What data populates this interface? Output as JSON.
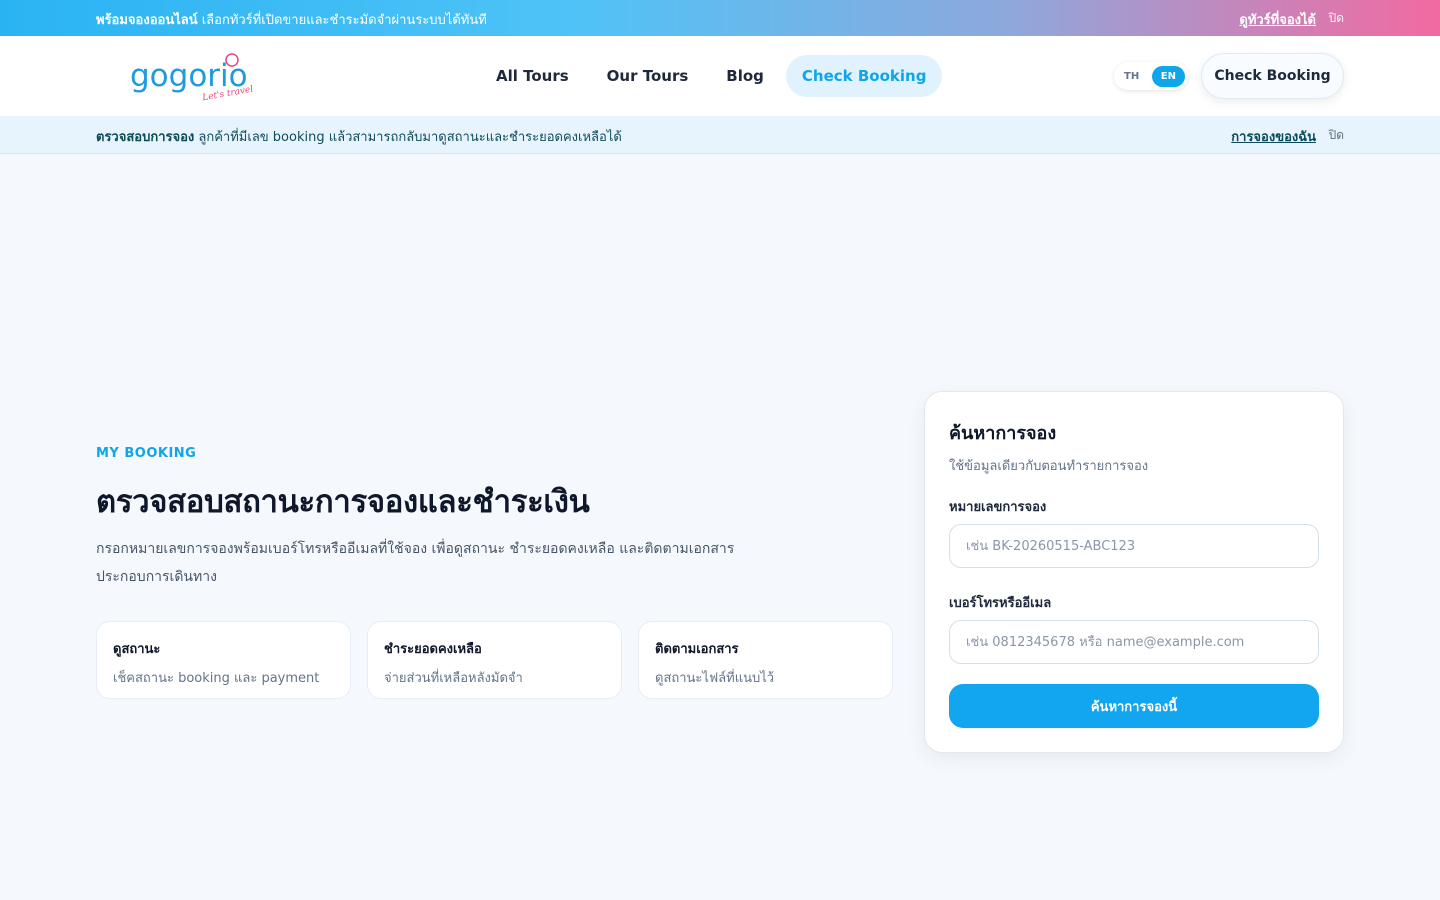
{
  "promo": {
    "bold": "พร้อมจองออนไลน์",
    "text": " เลือกทัวร์ที่เปิดขายและชำระมัดจำผ่านระบบได้ทันที",
    "link": "ดูทัวร์ที่จองได้",
    "close": "ปิด"
  },
  "header": {
    "logo_text": "gogorio",
    "logo_tagline": "Let's travel",
    "nav": [
      "All Tours",
      "Our Tours",
      "Blog",
      "Check Booking"
    ],
    "lang_th": "TH",
    "lang_en": "EN",
    "cta": "Check Booking"
  },
  "notice": {
    "bold": "ตรวจสอบการจอง",
    "text": " ลูกค้าที่มีเลข booking แล้วสามารถกลับมาดูสถานะและชำระยอดคงเหลือได้",
    "link": "การจองของฉัน",
    "close": "ปิด"
  },
  "hero": {
    "eyebrow": "MY BOOKING",
    "title": "ตรวจสอบสถานะการจองและชำระเงิน",
    "description": "กรอกหมายเลขการจองพร้อมเบอร์โทรหรืออีเมลที่ใช้จอง เพื่อดูสถานะ ชำระยอดคงเหลือ และติดตามเอกสารประกอบการเดินทาง"
  },
  "features": [
    {
      "title": "ดูสถานะ",
      "desc": "เช็คสถานะ booking และ payment"
    },
    {
      "title": "ชำระยอดคงเหลือ",
      "desc": "จ่ายส่วนที่เหลือหลังมัดจำ"
    },
    {
      "title": "ติดตามเอกสาร",
      "desc": "ดูสถานะไฟล์ที่แนบไว้"
    }
  ],
  "search": {
    "title": "ค้นหาการจอง",
    "subtitle": "ใช้ข้อมูลเดียวกับตอนทำรายการจอง",
    "booking_label": "หมายเลขการจอง",
    "booking_placeholder": "เช่น BK-20260515-ABC123",
    "contact_label": "เบอร์โทรหรืออีเมล",
    "contact_placeholder": "เช่น 0812345678 หรือ name@example.com",
    "submit": "ค้นหาการจองนี้"
  },
  "colors": {
    "accent": "#0ea5e9",
    "button": "#11a6ef",
    "logo_blue": "#1e9be0",
    "logo_pink": "#e5487f"
  }
}
